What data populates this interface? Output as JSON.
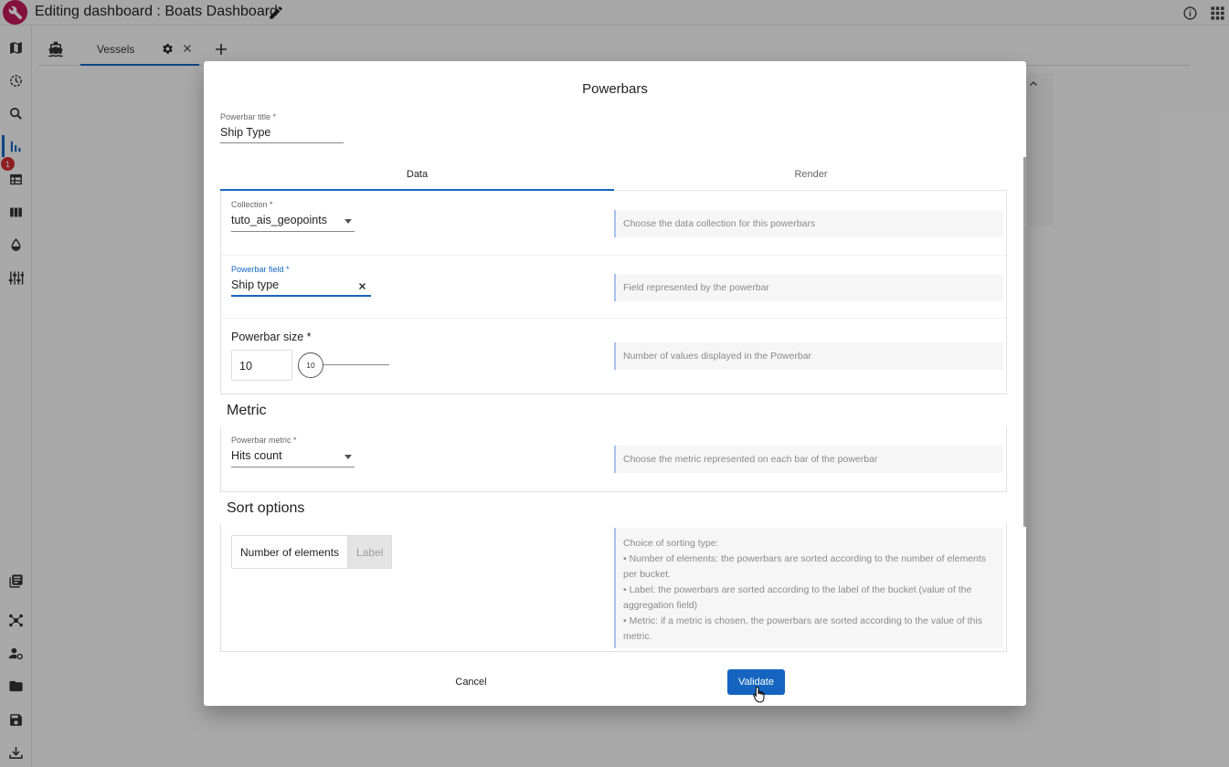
{
  "app": {
    "title": "Editing dashboard : Boats Dashboard",
    "badge_count": "1"
  },
  "tabs": {
    "vessels_label": "Vessels"
  },
  "dialog": {
    "title": "Powerbars",
    "powerbar_title_label": "Powerbar title *",
    "powerbar_title_value": "Ship Type",
    "tab_data": "Data",
    "tab_render": "Render",
    "collection_label": "Collection *",
    "collection_value": "tuto_ais_geopoints",
    "collection_help": "Choose the data collection for this powerbars",
    "field_label": "Powerbar field *",
    "field_value": "Ship type",
    "field_help": "Field represented by the powerbar",
    "size_label": "Powerbar size *",
    "size_value": "10",
    "size_slider_value": "10",
    "size_help": "Number of values displayed in the Powerbar",
    "metric_heading": "Metric",
    "metric_label": "Powerbar metric *",
    "metric_value": "Hits count",
    "metric_help": "Choose the metric represented on each bar of the powerbar",
    "sort_heading": "Sort options",
    "sort_option_elements": "Number of elements",
    "sort_option_label": "Label",
    "sort_help": [
      "Choice of sorting type:",
      "• Number of elements: the powerbars are sorted according to the number of elements per bucket.",
      "• Label: the powerbars are sorted according to the label of the bucket (value of the aggregation field)",
      "• Metric: if a metric is chosen, the powerbars are sorted according to the value of this metric."
    ],
    "cancel_label": "Cancel",
    "validate_label": "Validate"
  },
  "colors": {
    "primary": "#1565c0",
    "logo": "#c2185b",
    "badge": "#d32f2f"
  }
}
